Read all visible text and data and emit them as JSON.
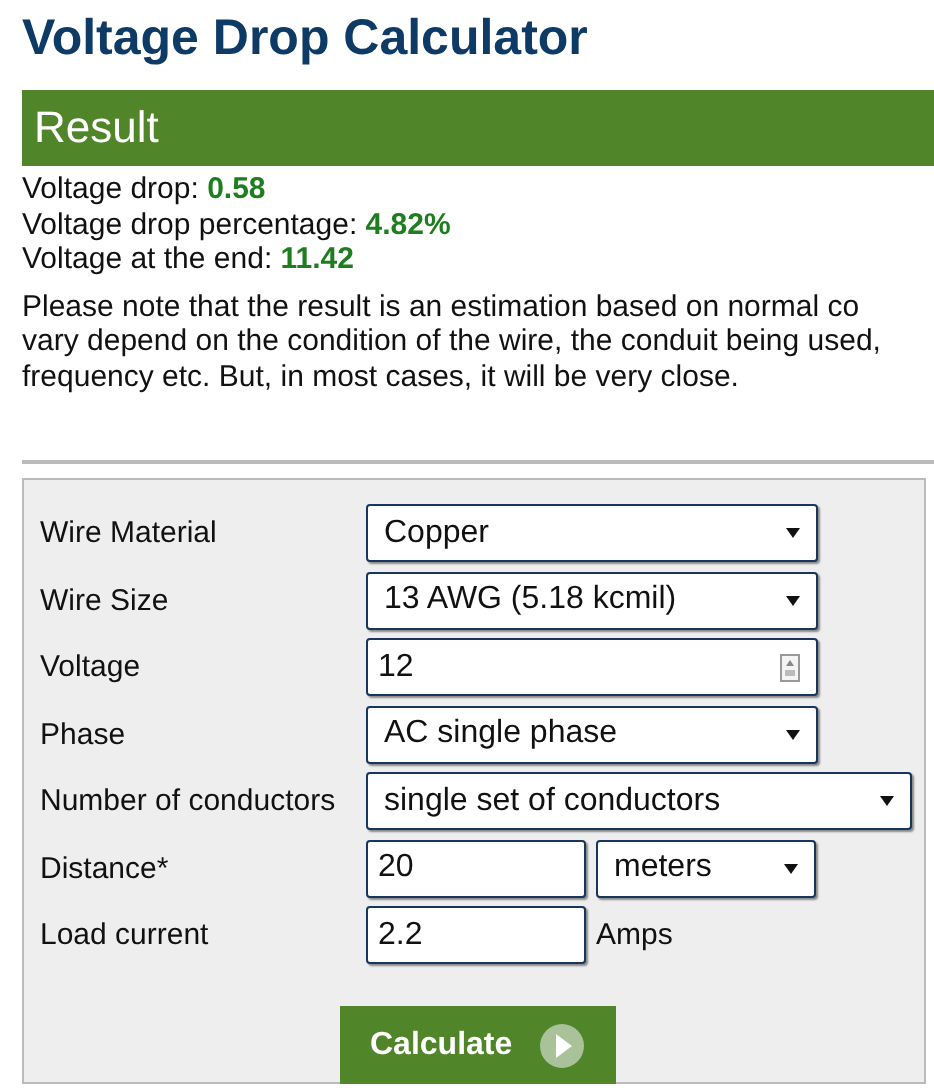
{
  "title": "Voltage Drop Calculator",
  "result": {
    "heading": "Result",
    "values": [
      {
        "label": "Voltage drop:",
        "value": "0.58"
      },
      {
        "label": "Voltage drop percentage:",
        "value": "4.82%"
      },
      {
        "label": "Voltage at the end:",
        "value": "11.42"
      }
    ],
    "note_lines": [
      "Please note that the result is an estimation based on normal co",
      "vary depend on the condition of the wire, the conduit being used,",
      "frequency etc. But, in most cases, it will be very close."
    ]
  },
  "form": {
    "rows": [
      {
        "label": "Wire Material",
        "kind": "select",
        "value": "Copper"
      },
      {
        "label": "Wire Size",
        "kind": "select",
        "value": "13 AWG (5.18 kcmil)"
      },
      {
        "label": "Voltage",
        "kind": "number",
        "value": "12"
      },
      {
        "label": "Phase",
        "kind": "select",
        "value": "AC single phase"
      },
      {
        "label": "Number of conductors",
        "kind": "wide_select",
        "value": "single set of conductors"
      },
      {
        "label": "Distance*",
        "kind": "input_unit",
        "value": "20",
        "unit": "meters"
      },
      {
        "label": "Load current",
        "kind": "input_suffix",
        "value": "2.2",
        "suffix": "Amps"
      }
    ],
    "button": "Calculate"
  }
}
